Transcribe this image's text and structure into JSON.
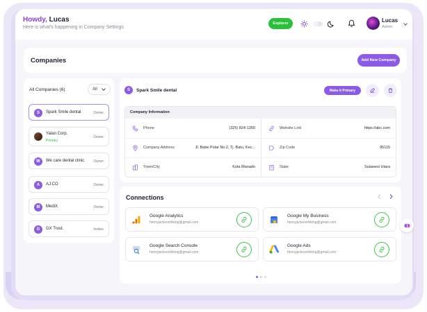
{
  "header": {
    "greeting_prefix": "Howdy,",
    "greeting_name": "Lucas",
    "subtitle": "Here is what's happening in Company Settings",
    "explorer_label": "Explorer",
    "user_name": "Lucas",
    "user_role": "Admin"
  },
  "companies": {
    "title": "Companies",
    "add_label": "Add New Company",
    "list_heading": "All Companies (6)",
    "filter_value": "All",
    "items": [
      {
        "initial": "S",
        "name": "Spark Smile dental",
        "role": "Owner",
        "sub": ""
      },
      {
        "initial": "",
        "name": "Yalan Corp.",
        "role": "Owner",
        "sub": "Primary"
      },
      {
        "initial": "W",
        "name": "We care dental clinic",
        "role": "Owner",
        "sub": ""
      },
      {
        "initial": "A",
        "name": "AJ.CO",
        "role": "Owner",
        "sub": ""
      },
      {
        "initial": "M",
        "name": "MediX",
        "role": "Owner",
        "sub": ""
      },
      {
        "initial": "G",
        "name": "GX Trust.",
        "role": "Invitee",
        "sub": ""
      }
    ]
  },
  "detail": {
    "initial": "S",
    "name": "Spark Smile dental",
    "make_primary_label": "Make it Primary",
    "info_title": "Company Information",
    "left": [
      {
        "label": "Phone",
        "value": "(325) 824-1350"
      },
      {
        "label": "Company Address",
        "value": "Jl. Babe Polar No.2, Tj. Batu, Kec..."
      },
      {
        "label": "Town/City",
        "value": "Kota Manado"
      }
    ],
    "right": [
      {
        "label": "Website Link",
        "value": "https://abc.com"
      },
      {
        "label": "Zip Code",
        "value": "95115"
      },
      {
        "label": "State",
        "value": "Sulawesi Utara"
      }
    ]
  },
  "connections": {
    "title": "Connections",
    "items": [
      {
        "name": "Google Analytics",
        "email": "henryjacksonhiking@gmail.com",
        "logo": "google-analytics-icon"
      },
      {
        "name": "Google My Business",
        "email": "henryjacksonhiking@gmail.com",
        "logo": "google-my-business-icon"
      },
      {
        "name": "Google Search Console",
        "email": "henryjacksonhiking@gmail.com",
        "logo": "google-search-console-icon"
      },
      {
        "name": "Google Ads",
        "email": "henryjacksonhiking@gmail.com",
        "logo": "google-ads-icon"
      }
    ]
  },
  "colors": {
    "accent": "#8b5be8",
    "success": "#2bbf3a",
    "frame": "#e2dcf6"
  }
}
